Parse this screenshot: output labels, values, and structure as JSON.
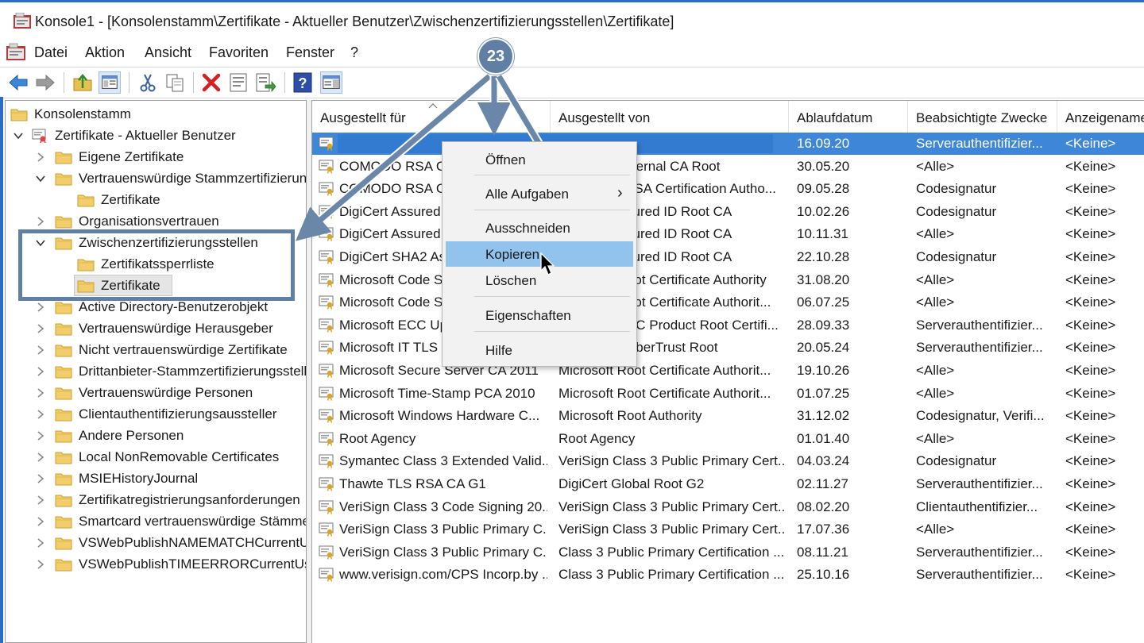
{
  "window": {
    "title": "Konsole1 - [Konsolenstamm\\Zertifikate - Aktueller Benutzer\\Zwischenzertifizierungsstellen\\Zertifikate]"
  },
  "menubar": {
    "items": [
      "Datei",
      "Aktion",
      "Ansicht",
      "Favoriten",
      "Fenster",
      "?"
    ]
  },
  "toolbar": {
    "icons": [
      "back-arrow-icon",
      "forward-arrow-icon",
      "up-folder-icon",
      "show-hide-tree-icon",
      "cut-icon",
      "copy-icon",
      "delete-icon",
      "properties-icon",
      "export-list-icon",
      "help-icon",
      "action-pane-icon"
    ]
  },
  "tree": {
    "root": "Konsolenstamm",
    "store": "Zertifikate - Aktueller Benutzer",
    "items": [
      "Eigene Zertifikate",
      "Vertrauenswürdige Stammzertifizierungsstellen",
      "Zertifikate",
      "Organisationsvertrauen",
      "Zwischenzertifizierungsstellen",
      "Zertifikatssperrliste",
      "Zertifikate",
      "Active Directory-Benutzerobjekt",
      "Vertrauenswürdige Herausgeber",
      "Nicht vertrauenswürdige Zertifikate",
      "Drittanbieter-Stammzertifizierungsstellen",
      "Vertrauenswürdige Personen",
      "Clientauthentifizierungsaussteller",
      "Andere Personen",
      "Local NonRemovable Certificates",
      "MSIEHistoryJournal",
      "Zertifikatregistrierungsanforderungen",
      "Smartcard vertrauenswürdige Stämme",
      "VSWebPublishNAMEMATCHCurrentUser",
      "VSWebPublishTIMEERRORCurrentUser"
    ]
  },
  "list": {
    "columns": [
      "Ausgestellt für",
      "Ausgestellt von",
      "Ablaufdatum",
      "Beabsichtigte Zwecke",
      "Anzeigename"
    ],
    "rows": [
      [
        "",
        "",
        "16.09.20",
        "Serverauthentifizier...",
        "<Keine>"
      ],
      [
        "COMODO RSA Certification Authority",
        "AddTrust External CA Root",
        "30.05.20",
        "<Alle>",
        "<Keine>"
      ],
      [
        "COMODO RSA Code Signing CA",
        "COMODO RSA Certification Autho...",
        "09.05.28",
        "Codesignatur",
        "<Keine>"
      ],
      [
        "DigiCert Assured ID Code Signing CA",
        "DigiCert Assured ID Root CA",
        "10.02.26",
        "Codesignatur",
        "<Keine>"
      ],
      [
        "DigiCert Assured ID Root CA",
        "DigiCert Assured ID Root CA",
        "10.11.31",
        "<Alle>",
        "<Keine>"
      ],
      [
        "DigiCert SHA2 Assured ID Code Signing CA",
        "DigiCert Assured ID Root CA",
        "22.10.28",
        "Codesignatur",
        "<Keine>"
      ],
      [
        "Microsoft Code Signing PCA",
        "Microsoft Root Certificate Authority",
        "31.08.20",
        "<Alle>",
        "<Keine>"
      ],
      [
        "Microsoft Code Signing PCA 2011",
        "Microsoft Root Certificate Authorit...",
        "06.07.25",
        "<Alle>",
        "<Keine>"
      ],
      [
        "Microsoft ECC Update Secure Server CA",
        "Microsoft ECC Product Root Certifi...",
        "28.09.33",
        "Serverauthentifizier...",
        "<Keine>"
      ],
      [
        "Microsoft IT TLS CA 1",
        "Baltimore CyberTrust Root",
        "20.05.24",
        "Serverauthentifizier...",
        "<Keine>"
      ],
      [
        "Microsoft Secure Server CA 2011",
        "Microsoft Root Certificate Authorit...",
        "19.10.26",
        "<Alle>",
        "<Keine>"
      ],
      [
        "Microsoft Time-Stamp PCA 2010",
        "Microsoft Root Certificate Authorit...",
        "01.07.25",
        "<Alle>",
        "<Keine>"
      ],
      [
        "Microsoft Windows Hardware C...",
        "Microsoft Root Authority",
        "31.12.02",
        "Codesignatur, Verifi...",
        "<Keine>"
      ],
      [
        "Root Agency",
        "Root Agency",
        "01.01.40",
        "<Alle>",
        "<Keine>"
      ],
      [
        "Symantec Class 3 Extended Valid...",
        "VeriSign Class 3 Public Primary Cert...",
        "04.03.24",
        "Codesignatur",
        "<Keine>"
      ],
      [
        "Thawte TLS RSA CA G1",
        "DigiCert Global Root G2",
        "02.11.27",
        "Serverauthentifizier...",
        "<Keine>"
      ],
      [
        "VeriSign Class 3 Code Signing 20...",
        "VeriSign Class 3 Public Primary Cert...",
        "08.02.20",
        "Clientauthentifizier...",
        "<Keine>"
      ],
      [
        "VeriSign Class 3 Public Primary C...",
        "VeriSign Class 3 Public Primary Cert...",
        "17.07.36",
        "<Alle>",
        "<Keine>"
      ],
      [
        "VeriSign Class 3 Public Primary C...",
        "Class 3 Public Primary Certification ...",
        "08.11.21",
        "Serverauthentifizier...",
        "<Keine>"
      ],
      [
        "www.verisign.com/CPS Incorp.by ...",
        "Class 3 Public Primary Certification ...",
        "25.10.16",
        "Serverauthentifizier...",
        "<Keine>"
      ]
    ]
  },
  "context_menu": {
    "open": "Öffnen",
    "all_tasks": "Alle Aufgaben",
    "cut": "Ausschneiden",
    "copy": "Kopieren",
    "delete": "Löschen",
    "properties": "Eigenschaften",
    "help": "Hilfe",
    "submenu_arrow": "›"
  },
  "callout": {
    "number": "23",
    "color": "#5f7fa4"
  },
  "colors": {
    "selection": "#3d86d8",
    "menu_highlight": "#91c3ec",
    "window_border": "#2b6cc4"
  }
}
